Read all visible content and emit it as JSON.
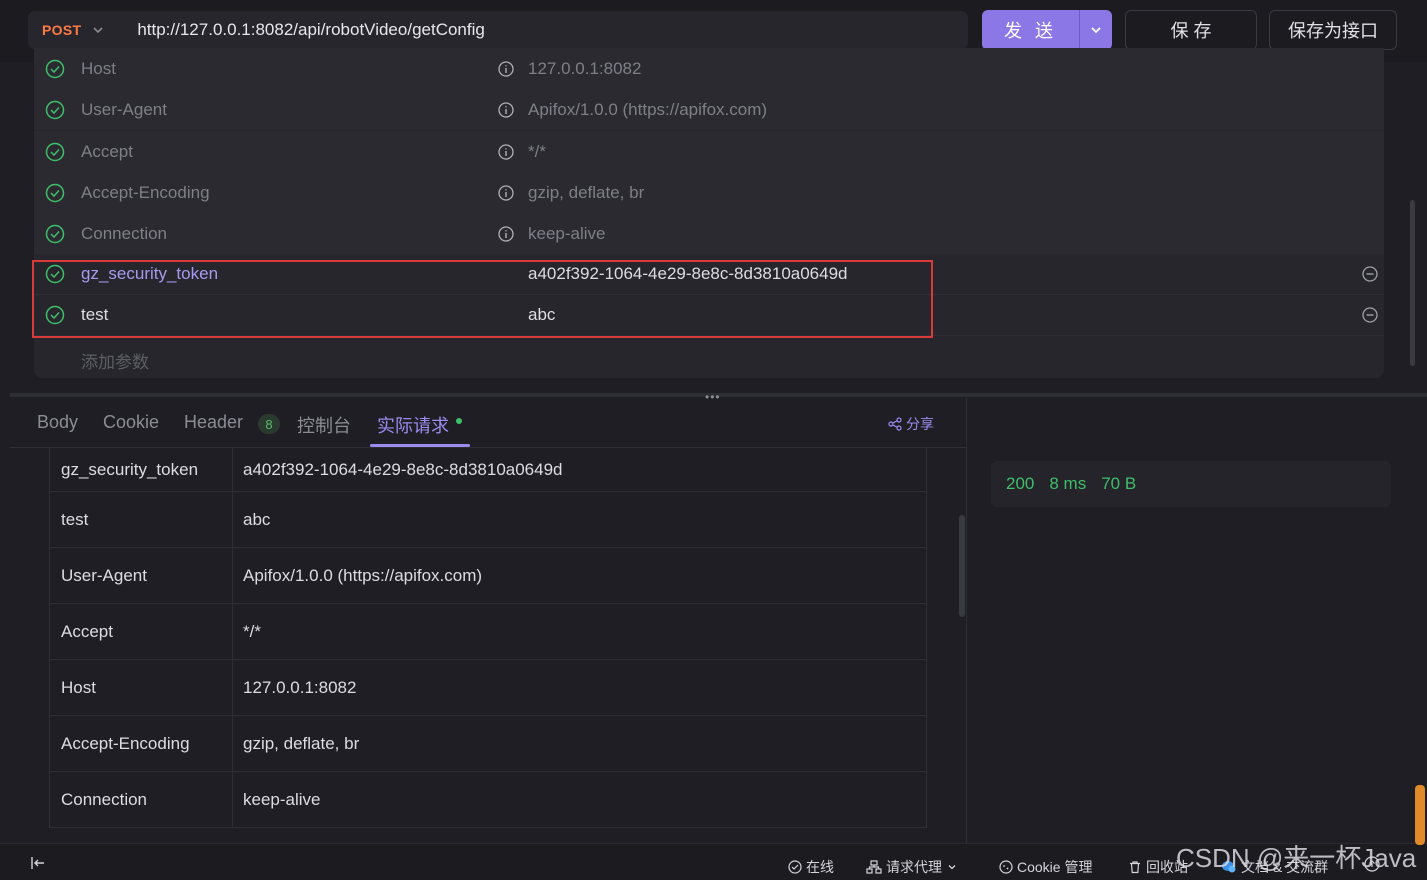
{
  "request": {
    "method": "POST",
    "url": "http://127.0.0.1:8082/api/robotVideo/getConfig",
    "send_label": "发 送",
    "save_label": "保 存",
    "save_as_label": "保存为接口"
  },
  "params": {
    "auto_rows": [
      {
        "key": "Host",
        "value": "127.0.0.1:8082"
      },
      {
        "key": "User-Agent",
        "value": "Apifox/1.0.0 (https://apifox.com)"
      },
      {
        "key": "Accept",
        "value": "*/*"
      },
      {
        "key": "Accept-Encoding",
        "value": "gzip, deflate, br"
      },
      {
        "key": "Connection",
        "value": "keep-alive"
      }
    ],
    "user_rows": [
      {
        "key": "gz_security_token",
        "value": "a402f392-1064-4e29-8e8c-8d3810a0649d"
      },
      {
        "key": "test",
        "value": "abc"
      }
    ],
    "add_placeholder": "添加参数"
  },
  "tabs": {
    "body": "Body",
    "cookie": "Cookie",
    "header": "Header",
    "header_count": "8",
    "console": "控制台",
    "actual": "实际请求",
    "share": "分享"
  },
  "actual_request": [
    {
      "key": "gz_security_token",
      "value": "a402f392-1064-4e29-8e8c-8d3810a0649d"
    },
    {
      "key": "test",
      "value": "abc"
    },
    {
      "key": "User-Agent",
      "value": "Apifox/1.0.0 (https://apifox.com)"
    },
    {
      "key": "Accept",
      "value": "*/*"
    },
    {
      "key": "Host",
      "value": "127.0.0.1:8082"
    },
    {
      "key": "Accept-Encoding",
      "value": "gzip, deflate, br"
    },
    {
      "key": "Connection",
      "value": "keep-alive"
    }
  ],
  "response": {
    "status": "200",
    "time": "8 ms",
    "size": "70 B"
  },
  "statusbar": {
    "online": "在线",
    "proxy": "请求代理",
    "cookie": "Cookie 管理",
    "recycle": "回收站",
    "docs": "文档 & 交流群"
  },
  "watermark": "CSDN @来一杯Java",
  "colors": {
    "accent": "#8b78e6",
    "method": "#ff7a45",
    "success": "#3fbf6a",
    "highlight": "#d93a3a"
  }
}
